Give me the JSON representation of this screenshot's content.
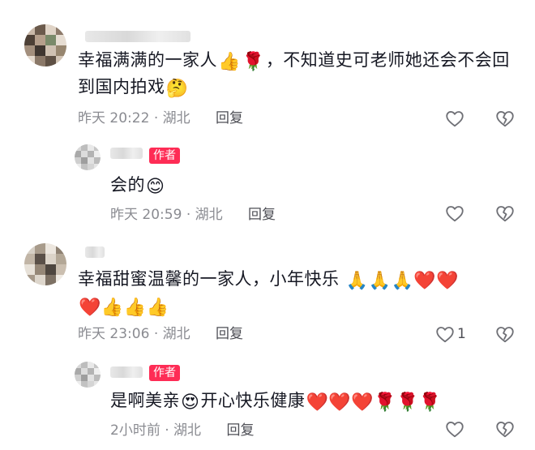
{
  "comments": [
    {
      "text_1": "幸福满满的一家人",
      "emoji_1": "👍",
      "emoji_2": "🌹",
      "text_2": "，不知道史可老师她还会不会回到国内拍戏",
      "emoji_3": "🤔",
      "time": "昨天 20:22",
      "location": "湖北",
      "reply_label": "回复",
      "like_icon": "heart-outline-icon",
      "dislike_icon": "broken-heart-icon"
    },
    {
      "badge": "作者",
      "text": "会的",
      "emoji": "😊",
      "time": "昨天 20:59",
      "location": "湖北",
      "reply_label": "回复",
      "like_icon": "heart-outline-icon",
      "dislike_icon": "broken-heart-icon"
    },
    {
      "text": "幸福甜蜜温馨的一家人，小年快乐",
      "emojis_line1": "🙏🙏🙏❤️❤️",
      "emojis_line2": "❤️👍👍👍",
      "time": "昨天 23:06",
      "location": "湖北",
      "reply_label": "回复",
      "like_count": "1",
      "like_icon": "heart-outline-icon",
      "dislike_icon": "broken-heart-icon"
    },
    {
      "badge": "作者",
      "text_1": "是啊美亲",
      "emoji_1": "😍",
      "text_2": "开心快乐健康",
      "emojis": "❤️❤️❤️🌹🌹🌹",
      "time": "2小时前",
      "location": "湖北",
      "reply_label": "回复",
      "like_icon": "heart-outline-icon",
      "dislike_icon": "broken-heart-icon"
    }
  ],
  "separator": "·"
}
